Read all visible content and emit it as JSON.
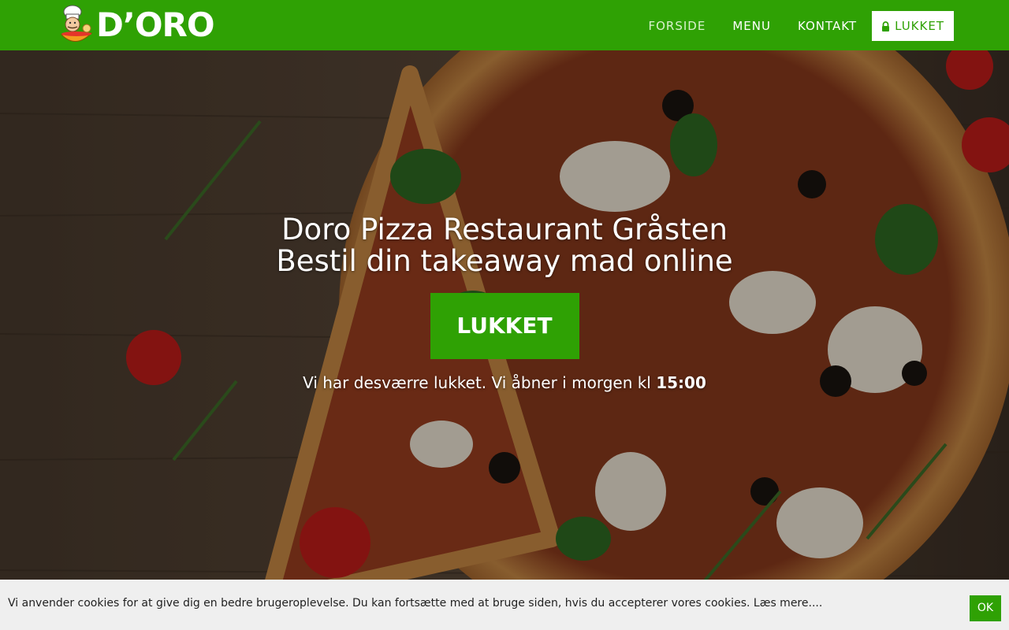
{
  "brand": {
    "logo_text": "D’ORO",
    "colors": {
      "primary": "#2fa104",
      "navbar_text": "#ffffff",
      "cookie_bg": "#efefef"
    }
  },
  "nav": {
    "items": [
      {
        "label": "FORSIDE"
      },
      {
        "label": "MENU"
      },
      {
        "label": "KONTAKT"
      }
    ],
    "status_button": {
      "label": "LUKKET",
      "icon": "lock-icon"
    }
  },
  "hero": {
    "title_line1": "Doro Pizza Restaurant Gråsten",
    "title_line2": "Bestil din takeaway mad online",
    "button_label": "LUKKET",
    "note_text": "Vi har desværre lukket. Vi åbner i morgen kl ",
    "note_time": "15:00"
  },
  "cookie": {
    "text": "Vi anvender cookies for at give dig en bedre brugeroplevelse. Du kan fortsætte med at bruge siden, hvis du accepterer vores cookies. ",
    "more_label": "Læs mere....",
    "ok_label": "OK"
  }
}
